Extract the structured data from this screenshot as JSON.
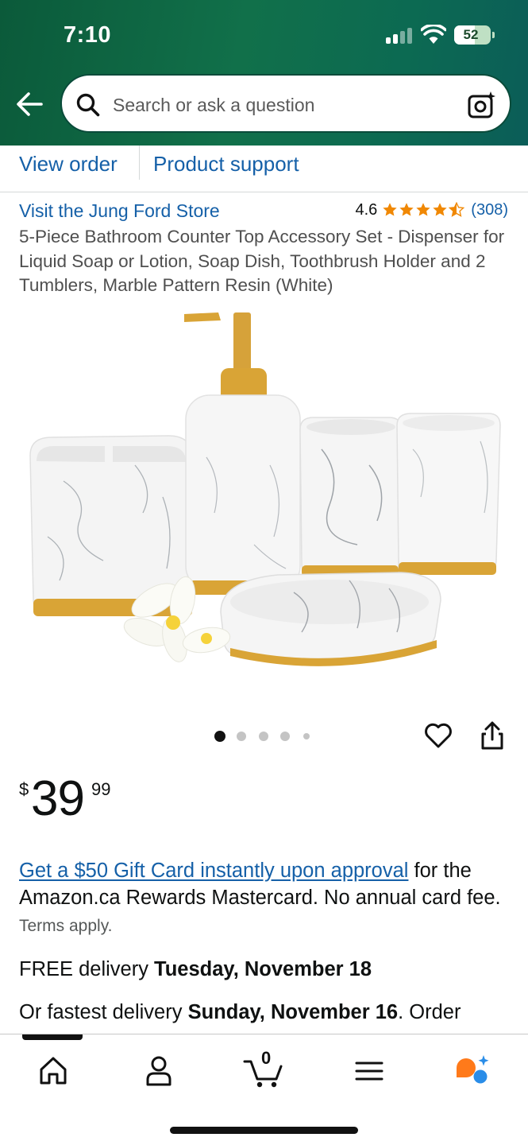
{
  "status_bar": {
    "time": "7:10",
    "battery": "52"
  },
  "search": {
    "placeholder": "Search or ask a question"
  },
  "order_links": {
    "view_order": "View order",
    "product_support": "Product support"
  },
  "store": {
    "link_text": "Visit the Jung Ford Store"
  },
  "rating": {
    "value": "4.6",
    "stars": 4.5,
    "count": "(308)"
  },
  "product": {
    "title": "5-Piece Bathroom Counter Top Accessory Set - Dispenser for Liquid Soap or Lotion, Soap Dish, Toothbrush Holder and 2 Tumblers, Marble Pattern Resin (White)",
    "image_count": 5,
    "active_image_index": 0
  },
  "price": {
    "symbol": "$",
    "whole": "39",
    "fraction": "99"
  },
  "offer": {
    "link_text": "Get a $50 Gift Card instantly upon approval",
    "text": " for the Amazon.ca Rewards Mastercard. No annual card fee.",
    "terms": "Terms apply."
  },
  "delivery": {
    "free_prefix": "FREE delivery ",
    "free_date": "Tuesday, November 18",
    "fastest_prefix": "Or fastest delivery ",
    "fastest_date": "Sunday, November 16",
    "fastest_suffix": ". Order"
  },
  "bottom_nav": {
    "cart_count": "0",
    "items": [
      "home-icon",
      "account-icon",
      "cart-icon",
      "menu-icon",
      "rufus-icon"
    ]
  },
  "colors": {
    "header_green": "#11704a",
    "link_blue": "#1560a8",
    "star_orange": "#f08804",
    "rufus_orange": "#ff7a1a",
    "rufus_blue": "#2a8de8"
  }
}
